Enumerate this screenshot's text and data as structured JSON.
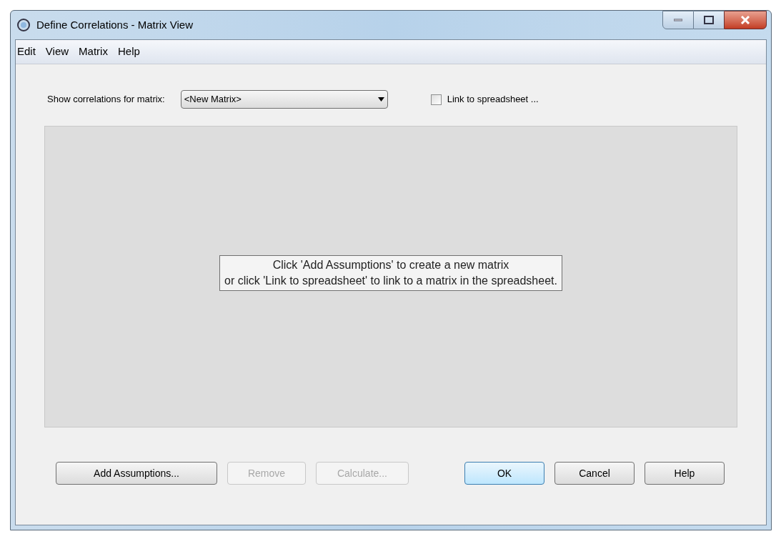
{
  "window": {
    "title": "Define Correlations - Matrix View"
  },
  "menu": [
    "Edit",
    "View",
    "Matrix",
    "Help"
  ],
  "matrix_select": {
    "label": "Show correlations for matrix:",
    "value": "<New Matrix>"
  },
  "link_checkbox": {
    "label": "Link to spreadsheet ...",
    "checked": false
  },
  "message": [
    "Click 'Add Assumptions' to create a new matrix",
    "or click 'Link to spreadsheet' to link to a matrix in the spreadsheet."
  ],
  "left_buttons": [
    {
      "label": "Add Assumptions...",
      "disabled": false
    },
    {
      "label": "Remove",
      "disabled": true
    },
    {
      "label": "Calculate...",
      "disabled": true
    }
  ],
  "right_buttons": [
    {
      "label": "OK",
      "default": true
    },
    {
      "label": "Cancel",
      "default": false
    },
    {
      "label": "Help",
      "default": false
    }
  ]
}
